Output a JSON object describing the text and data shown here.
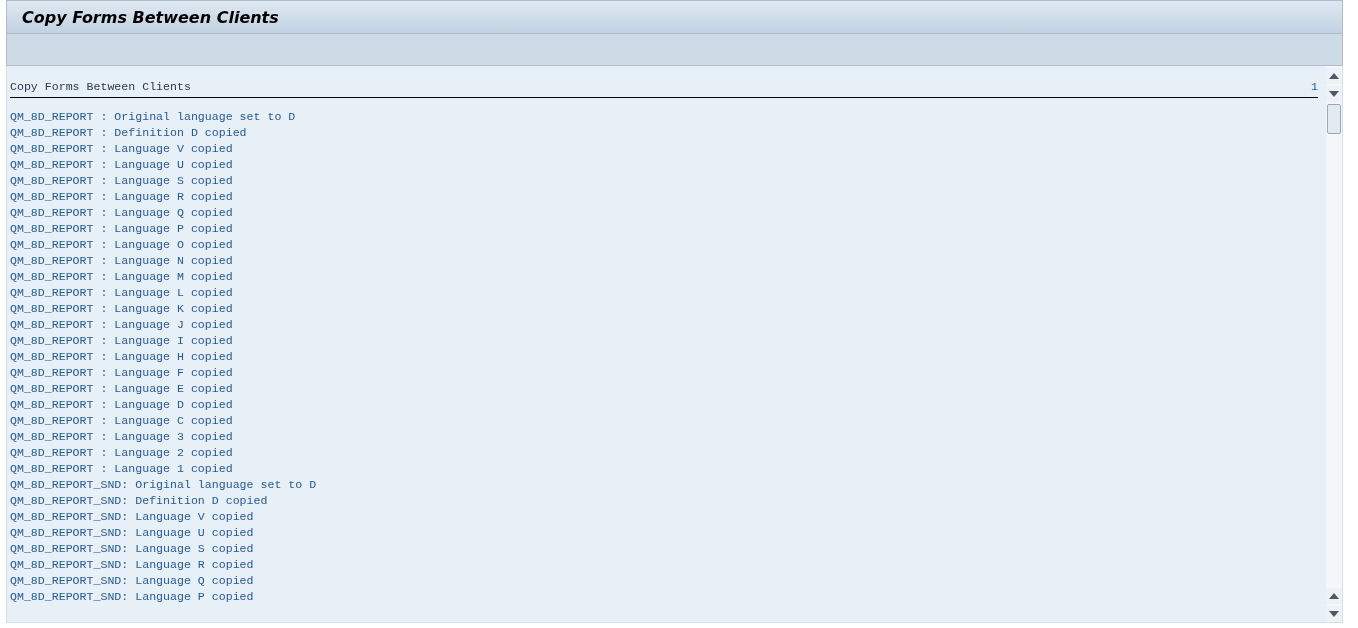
{
  "window": {
    "title": "Copy Forms Between Clients"
  },
  "list": {
    "heading": "Copy Forms Between Clients",
    "page": "1",
    "lines": [
      "QM_8D_REPORT : Original language set to D",
      "QM_8D_REPORT : Definition D copied",
      "QM_8D_REPORT : Language V copied",
      "QM_8D_REPORT : Language U copied",
      "QM_8D_REPORT : Language S copied",
      "QM_8D_REPORT : Language R copied",
      "QM_8D_REPORT : Language Q copied",
      "QM_8D_REPORT : Language P copied",
      "QM_8D_REPORT : Language O copied",
      "QM_8D_REPORT : Language N copied",
      "QM_8D_REPORT : Language M copied",
      "QM_8D_REPORT : Language L copied",
      "QM_8D_REPORT : Language K copied",
      "QM_8D_REPORT : Language J copied",
      "QM_8D_REPORT : Language I copied",
      "QM_8D_REPORT : Language H copied",
      "QM_8D_REPORT : Language F copied",
      "QM_8D_REPORT : Language E copied",
      "QM_8D_REPORT : Language D copied",
      "QM_8D_REPORT : Language C copied",
      "QM_8D_REPORT : Language 3 copied",
      "QM_8D_REPORT : Language 2 copied",
      "QM_8D_REPORT : Language 1 copied",
      "QM_8D_REPORT_SND: Original language set to D",
      "QM_8D_REPORT_SND: Definition D copied",
      "QM_8D_REPORT_SND: Language V copied",
      "QM_8D_REPORT_SND: Language U copied",
      "QM_8D_REPORT_SND: Language S copied",
      "QM_8D_REPORT_SND: Language R copied",
      "QM_8D_REPORT_SND: Language Q copied",
      "QM_8D_REPORT_SND: Language P copied"
    ]
  }
}
